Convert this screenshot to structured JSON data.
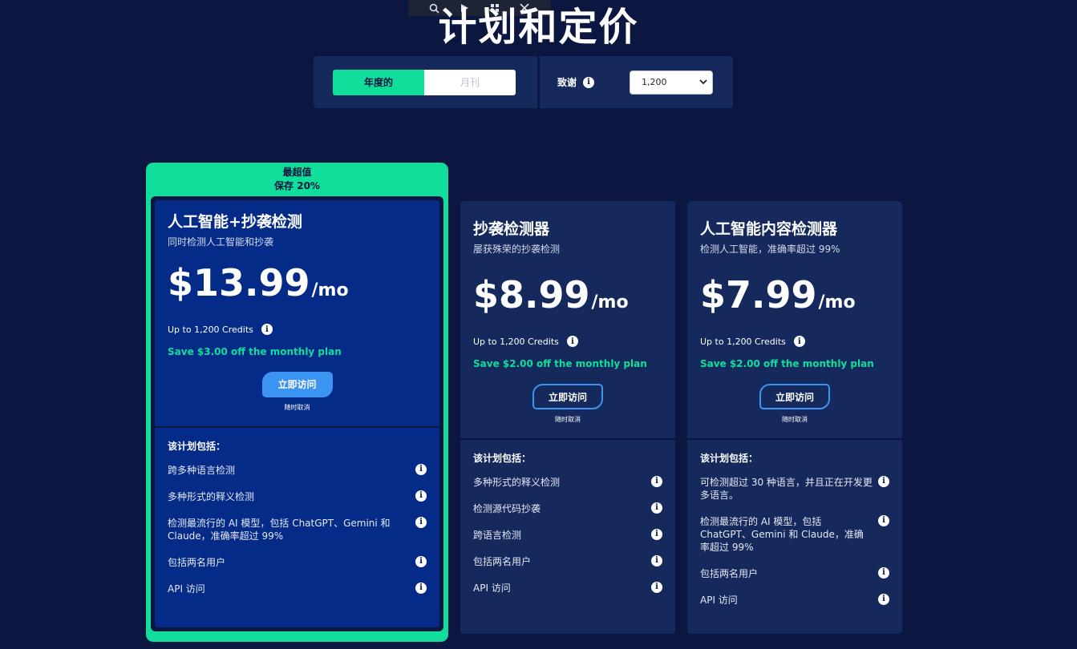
{
  "title": "计划和定价",
  "toolbar": {
    "icons": [
      "search-icon",
      "play-icon",
      "grid-icon",
      "close-icon"
    ]
  },
  "billing": {
    "annual_label": "年度的",
    "monthly_label": "月刊",
    "selected": "annual"
  },
  "credits": {
    "label": "致谢",
    "selected": "1,200"
  },
  "colors": {
    "background": "#0b1740",
    "accent_green": "#10de9a",
    "accent_blue": "#3b93f2",
    "card": "#15295d",
    "featured_card": "#042b88"
  },
  "plans": [
    {
      "badge_line1": "最超值",
      "badge_line2": "保存 20%",
      "title": "人工智能+抄袭检测",
      "subtitle": "同时检测人工智能和抄袭",
      "price": "$13.99",
      "per": "/mo",
      "credits": "Up to 1,200 Credits",
      "save": "Save $3.00 off the monthly plan",
      "cta": "立即访问",
      "cancel": "随时取消",
      "includes_title": "该计划包括：",
      "features": [
        "跨多种语言检测",
        "多种形式的释义检测",
        "检测最流行的 AI 模型，包括 ChatGPT、Gemini 和 Claude，准确率超过 99%",
        "包括两名用户",
        "API 访问"
      ]
    },
    {
      "title": "抄袭检测器",
      "subtitle": "屡获殊荣的抄袭检测",
      "price": "$8.99",
      "per": "/mo",
      "credits": "Up to 1,200 Credits",
      "save": "Save $2.00 off the monthly plan",
      "cta": "立即访问",
      "cancel": "随时取消",
      "includes_title": "该计划包括：",
      "features": [
        "多种形式的释义检测",
        "检测源代码抄袭",
        "跨语言检测",
        "包括两名用户",
        "API 访问"
      ]
    },
    {
      "title": "人工智能内容检测器",
      "subtitle": "检测人工智能，准确率超过 99%",
      "price": "$7.99",
      "per": "/mo",
      "credits": "Up to 1,200 Credits",
      "save": "Save $2.00 off the monthly plan",
      "cta": "立即访问",
      "cancel": "随时取消",
      "includes_title": "该计划包括：",
      "features": [
        "可检测超过 30 种语言，并且正在开发更多语言。",
        "检测最流行的 AI 模型，包括 ChatGPT、Gemini 和 Claude，准确率超过 99%",
        "包括两名用户",
        "API 访问"
      ]
    }
  ]
}
